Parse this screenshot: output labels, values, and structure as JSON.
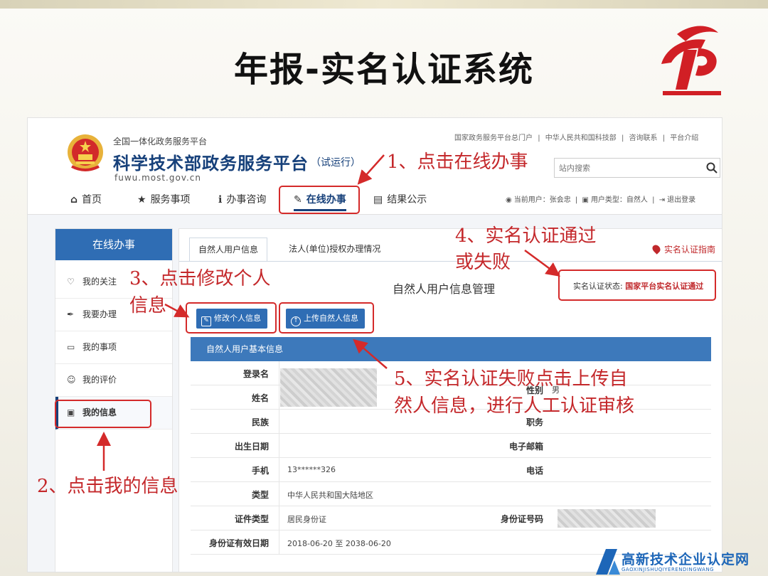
{
  "slide": {
    "title": "年报-实名认证系统"
  },
  "portal": {
    "subtitle": "全国一体化政务服务平台",
    "title": "科学技术部政务服务平台",
    "trial": "（试运行）",
    "url": "fuwu.most.gov.cn",
    "top_links": [
      "国家政务服务平台总门户",
      "|",
      "中华人民共和国科技部",
      "|",
      "咨询联系",
      "|",
      "平台介绍"
    ],
    "search_placeholder": "站内搜索"
  },
  "nav": {
    "items": [
      {
        "icon": "home-icon",
        "label": "首页"
      },
      {
        "icon": "star-icon",
        "label": "服务事项"
      },
      {
        "icon": "info-icon",
        "label": "办事咨询"
      },
      {
        "icon": "pencil-icon",
        "label": "在线办事"
      },
      {
        "icon": "document-icon",
        "label": "结果公示"
      }
    ],
    "user": [
      "当前用户：张会忠",
      "|",
      "用户类型：自然人",
      "|",
      "退出登录"
    ]
  },
  "sidebar": {
    "header": "在线办事",
    "items": [
      {
        "icon": "heart-icon",
        "label": "我的关注"
      },
      {
        "icon": "pen-icon",
        "label": "我要办理"
      },
      {
        "icon": "folder-icon",
        "label": "我的事项"
      },
      {
        "icon": "smile-icon",
        "label": "我的评价"
      },
      {
        "icon": "id-card-icon",
        "label": "我的信息"
      }
    ]
  },
  "main": {
    "tabs": [
      "自然人用户信息",
      "法人(单位)授权办理情况"
    ],
    "guide": "实名认证指南",
    "panel_title": "自然人用户信息管理",
    "status_label": "实名认证状态:",
    "status_value": "国家平台实名认证通过",
    "buttons": {
      "edit": "修改个人信息",
      "upload": "上传自然人信息"
    },
    "section_title": "自然人用户基本信息",
    "fields": {
      "login": "登录名",
      "name": "姓名",
      "gender_label": "性别",
      "gender_value": "男",
      "ethnicity": "民族",
      "job": "职务",
      "birth": "出生日期",
      "email": "电子邮箱",
      "phone": "手机",
      "phone_value": "13******326",
      "tel": "电话",
      "type": "类型",
      "type_value": "中华人民共和国大陆地区",
      "cert_type": "证件类型",
      "cert_type_value": "居民身份证",
      "id_number": "身份证号码",
      "validity": "身份证有效日期",
      "validity_value": "2018-06-20 至 2038-06-20"
    }
  },
  "annotations": {
    "a1": "1、点击在线办事",
    "a2": "2、点击我的信息",
    "a3_line1": "3、点击修改个人",
    "a3_line2": "信息",
    "a4_line1": "4、实名认证通过",
    "a4_line2": "或失败",
    "a5_line1": "5、实名认证失败点击上传自",
    "a5_line2": "然人信息，进行人工认证审核"
  },
  "watermark": {
    "text": "高新技术企业认定网",
    "sub": "GAOXINJISHUQIYERENDINGWANG"
  },
  "colors": {
    "annotation": "#c4282b",
    "primary": "#2f6db4",
    "status": "#c0282b"
  }
}
